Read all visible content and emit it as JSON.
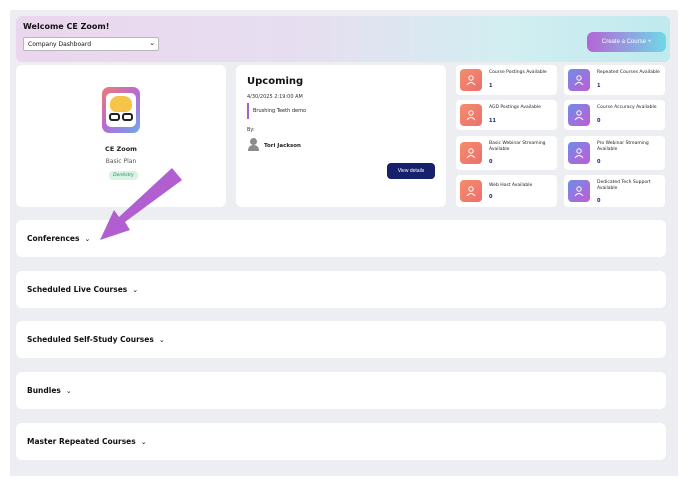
{
  "header": {
    "welcome": "Welcome CE Zoom!",
    "dashboard_select": "Company Dashboard",
    "create_button": "Create a Course  +"
  },
  "profile": {
    "name": "CE Zoom",
    "plan": "Basic Plan",
    "badge": "Dentistry"
  },
  "upcoming": {
    "title": "Upcoming",
    "date": "4/30/2025 2:19:00 AM",
    "course": "Brushing Teeth demo",
    "by_label": "By:",
    "presenter": "Tori Jackson",
    "view_button": "View details"
  },
  "stats": [
    {
      "label": "Course Postings Available",
      "value": "1"
    },
    {
      "label": "Repeated Courses Available",
      "value": "1"
    },
    {
      "label": "AGD Postings Available",
      "value": "11"
    },
    {
      "label": "Course Accuracy Available",
      "value": "0"
    },
    {
      "label": "Basic Webinar Streaming Available",
      "value": "0"
    },
    {
      "label": "Pro Webinar Streaming Available",
      "value": "0"
    },
    {
      "label": "Web Host Available",
      "value": "0"
    },
    {
      "label": "Dedicated Tech Support Available",
      "value": "0"
    }
  ],
  "sections": [
    {
      "label": "Conferences"
    },
    {
      "label": "Scheduled Live Courses"
    },
    {
      "label": "Scheduled Self-Study Courses"
    },
    {
      "label": "Bundles"
    },
    {
      "label": "Master Repeated Courses"
    }
  ],
  "icons": {
    "stat_icon": "users-icon",
    "chevron": "chevron-down-icon"
  },
  "colors": {
    "accent_purple": "#b565d6",
    "navy_button": "#16206b",
    "annotation_arrow": "#b15ed1"
  }
}
